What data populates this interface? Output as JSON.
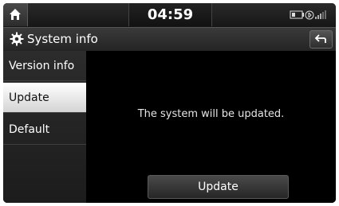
{
  "status_bar": {
    "time": "04:59",
    "home_icon": "home-icon",
    "status_icons": [
      "battery-icon",
      "bluetooth-icon",
      "signal-icon"
    ]
  },
  "header": {
    "title": "System info",
    "title_icon": "gear-icon",
    "back_icon": "back-arrow-icon"
  },
  "sidebar": {
    "items": [
      {
        "label": "Version info",
        "selected": false
      },
      {
        "label": "Update",
        "selected": true
      },
      {
        "label": "Default",
        "selected": false
      }
    ]
  },
  "content": {
    "message": "The system will be updated.",
    "update_button_label": "Update"
  },
  "colors": {
    "background": "#000000",
    "selected_item": "#ffffff"
  }
}
